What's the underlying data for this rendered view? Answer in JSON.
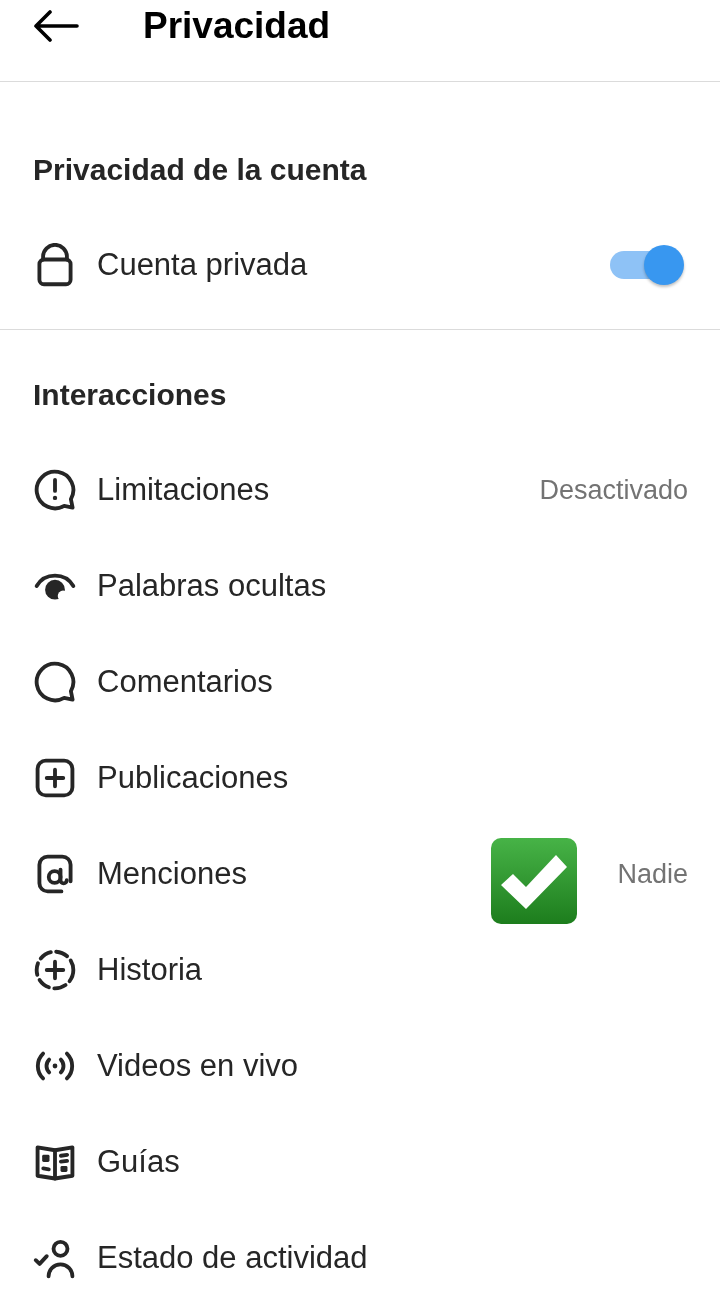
{
  "header": {
    "title": "Privacidad"
  },
  "sections": [
    {
      "heading": "Privacidad de la cuenta",
      "items": [
        {
          "kind": "toggle",
          "label": "Cuenta privada",
          "on": true
        }
      ]
    },
    {
      "heading": "Interacciones",
      "items": [
        {
          "kind": "link",
          "label": "Limitaciones",
          "value": "Desactivado"
        },
        {
          "kind": "link",
          "label": "Palabras ocultas"
        },
        {
          "kind": "link",
          "label": "Comentarios"
        },
        {
          "kind": "link",
          "label": "Publicaciones"
        },
        {
          "kind": "link",
          "label": "Menciones",
          "value": "Nadie"
        },
        {
          "kind": "link",
          "label": "Historia"
        },
        {
          "kind": "link",
          "label": "Videos en vivo"
        },
        {
          "kind": "link",
          "label": "Guías"
        },
        {
          "kind": "link",
          "label": "Estado de actividad"
        }
      ]
    }
  ]
}
